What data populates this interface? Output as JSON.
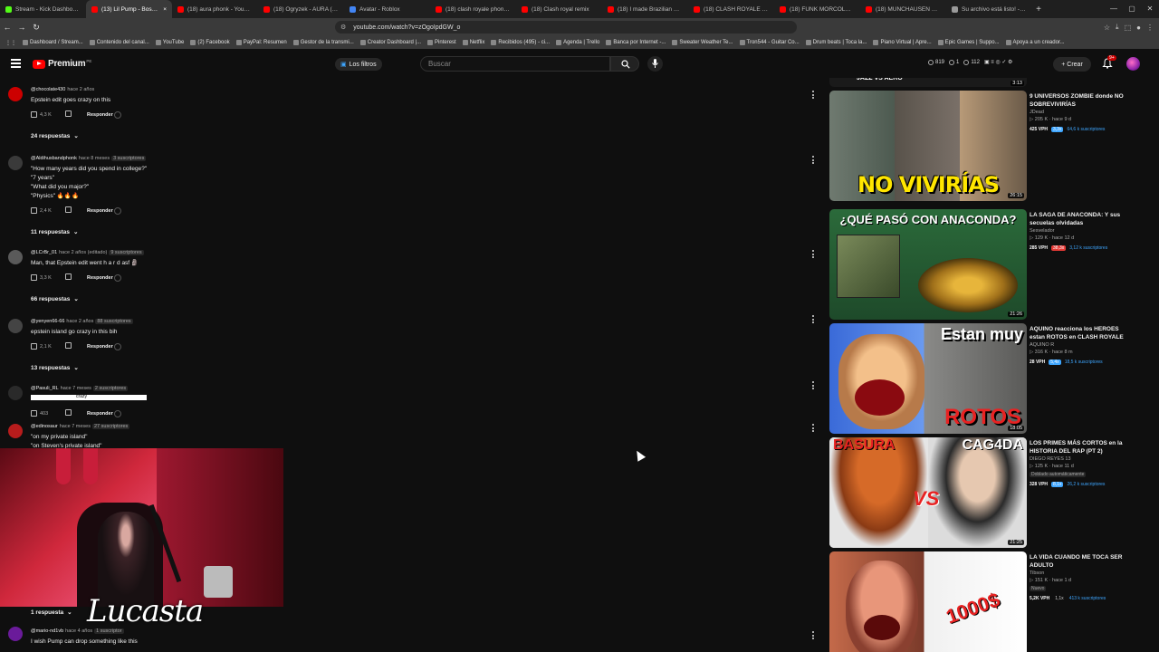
{
  "browser": {
    "tabs": [
      {
        "label": "Stream - Kick Dashboard",
        "fav": "green"
      },
      {
        "label": "(13) Lil Pump - Boss X",
        "fav": "red",
        "active": true
      },
      {
        "label": "(18) aura phonk - YouTube",
        "fav": "red"
      },
      {
        "label": "(18) Ogryzek - AURA (PHO",
        "fav": "red"
      },
      {
        "label": "Avatar - Roblox",
        "fav": "blue"
      },
      {
        "label": "(18) clash royale phonk dj",
        "fav": "red"
      },
      {
        "label": "(18) Clash royal remix",
        "fav": "red"
      },
      {
        "label": "(18) I made Brazilian Funk",
        "fav": "red"
      },
      {
        "label": "(18) CLASH ROYALE PHON",
        "fav": "red"
      },
      {
        "label": "(18) FUNK MORCOLE [SLOW",
        "fav": "red"
      },
      {
        "label": "(18) MUNCHAUSEN FUNK",
        "fav": "red"
      },
      {
        "label": "Su archivo está listo! - no T",
        "fav": "gray"
      }
    ],
    "url": "youtube.com/watch?v=zOgoIpdGW_o",
    "bookmarks": [
      "Dashboard / Stream...",
      "Contenido del canal...",
      "YouTube",
      "(2) Facebook",
      "PayPal: Resumen",
      "Gestor de la transmi...",
      "Creator Dashboard |...",
      "Pinterest",
      "Netflix",
      "Recibidos (495) - ci...",
      "Agenda | Trello",
      "Banca por Internet -...",
      "Sweater Weather Te...",
      "Tron544 - Guitar Co...",
      "Drum beats | Toca la...",
      "Piano Virtual | Apre...",
      "Epic Games | Suppo...",
      "Apoya a un creador..."
    ]
  },
  "header": {
    "logo": "Premium",
    "region": "PE",
    "filters_label": "Los filtros",
    "search_placeholder": "Buscar",
    "stats": [
      "819",
      "1",
      "112"
    ],
    "create_label": "Crear",
    "notif_count": "9+"
  },
  "comments": [
    {
      "user": "@chocolate430",
      "time": "hace 2 años",
      "subs": "",
      "lines": [
        "Epstein edit goes crazy on this"
      ],
      "likes": "4,3 K",
      "replies": "24 respuestas",
      "avatar": "#cc0000"
    },
    {
      "user": "@Aldihusbandphonk",
      "time": "hace 8 meses",
      "subs": "3 suscriptores",
      "lines": [
        "\"How many years did you spend in college?\"",
        "\"7 years\"",
        "\"What did you major?\"",
        "\"Physics\" 🔥🔥🔥"
      ],
      "likes": "2,4 K",
      "replies": "11 respuestas",
      "avatar": "#3a3a3a"
    },
    {
      "user": "@LCrBr_01",
      "time": "hace 2 años (editado)",
      "subs": "9 suscriptores",
      "lines": [
        "Man, that Epstein edit went h a r d asf 🗿"
      ],
      "likes": "3,3 K",
      "replies": "66 respuestas",
      "avatar": "#5a5a5a"
    },
    {
      "user": "@yenyen66-66",
      "time": "hace 2 años",
      "subs": "88 suscriptores",
      "lines": [
        "epstein island go crazy in this bih"
      ],
      "likes": "2,1 K",
      "replies": "13 respuestas",
      "avatar": "#444"
    },
    {
      "user": "@Pasuli_RL",
      "time": "hace 7 meses",
      "subs": "2 suscriptores",
      "lines": [
        "crazy"
      ],
      "likes": "403",
      "replies": "",
      "avatar": "#2a2a2a"
    },
    {
      "user": "@edinosaur",
      "time": "hace 7 meses",
      "subs": "27 suscriptores",
      "lines": [
        "\"on my private island\"",
        "\"on Steven's private island\""
      ],
      "likes": "",
      "replies": "1 respuesta",
      "avatar": "#b71c1c"
    },
    {
      "user": "@mario-nd1vb",
      "time": "hace 4 años",
      "subs": "1 suscriptor",
      "lines": [
        "I wish Pump can drop something like this"
      ],
      "likes": "",
      "replies": "",
      "avatar": "#6a1b9a"
    }
  ],
  "actions": {
    "reply_label": "Responder"
  },
  "overlay": {
    "streamer_name": "Lucasta"
  },
  "sidebar": {
    "top_strip_text": "JAZZ VS AERO",
    "top_duration": "3:13",
    "videos": [
      {
        "title": "9 UNIVERSOS ZOMBIE donde NO SOBREVIVIRÍAS",
        "channel": "JDead",
        "meta": "205 K · hace 9 d",
        "vph": "425 VPH",
        "mult": "3,3x",
        "mult_style": "blue",
        "subs": "64,6 k suscriptores",
        "duration": "26:15",
        "thumb_text": "NO VIVIRÍAS",
        "badge": ""
      },
      {
        "title": "LA SAGA DE ANACONDA: Y sus secuelas olvidadas",
        "channel": "Sesvelador",
        "meta": "129 K · hace 12 d",
        "vph": "285 VPH",
        "mult": "38,3x",
        "mult_style": "red",
        "subs": "3,12 k suscriptores",
        "duration": "21:26",
        "thumb_text": "¿QUÉ PASÓ CON ANACONDA?",
        "badge": ""
      },
      {
        "title": "AQUINO reacciona los HEROES estan ROTOS en CLASH ROYALE",
        "channel": "AQUINO R",
        "meta": "316 K · hace 8 m",
        "vph": "28 VPH",
        "mult": "5,4x",
        "mult_style": "blue",
        "subs": "18,5 k suscriptores",
        "duration": "18:05",
        "thumb_text": "Estan muy",
        "thumb_text2": "ROTOS",
        "badge": ""
      },
      {
        "title": "LOS PRIMES MÁS CORTOS en la HISTORIA DEL RAP (PT 2)",
        "channel": "DIEGO REYES 13",
        "meta": "125 K · hace 11 d",
        "vph": "328 VPH",
        "mult": "8,1x",
        "mult_style": "blue",
        "subs": "26,2 k suscriptores",
        "duration": "21:25",
        "thumb_text": "BASURA",
        "thumb_text2": "CAG4DA",
        "thumb_vs": "VS",
        "badge": "Doblado automáticamente"
      },
      {
        "title": "LA VIDA CUANDO ME TOCA SER ADULTO",
        "channel": "Tibson",
        "meta": "151 K · hace 1 d",
        "vph": "5,2K VPH",
        "mult": "1,1x",
        "mult_style": "plain",
        "subs": "413 k suscriptores",
        "duration": "",
        "thumb_text": "1000$",
        "badge": "Nuevo"
      }
    ]
  }
}
